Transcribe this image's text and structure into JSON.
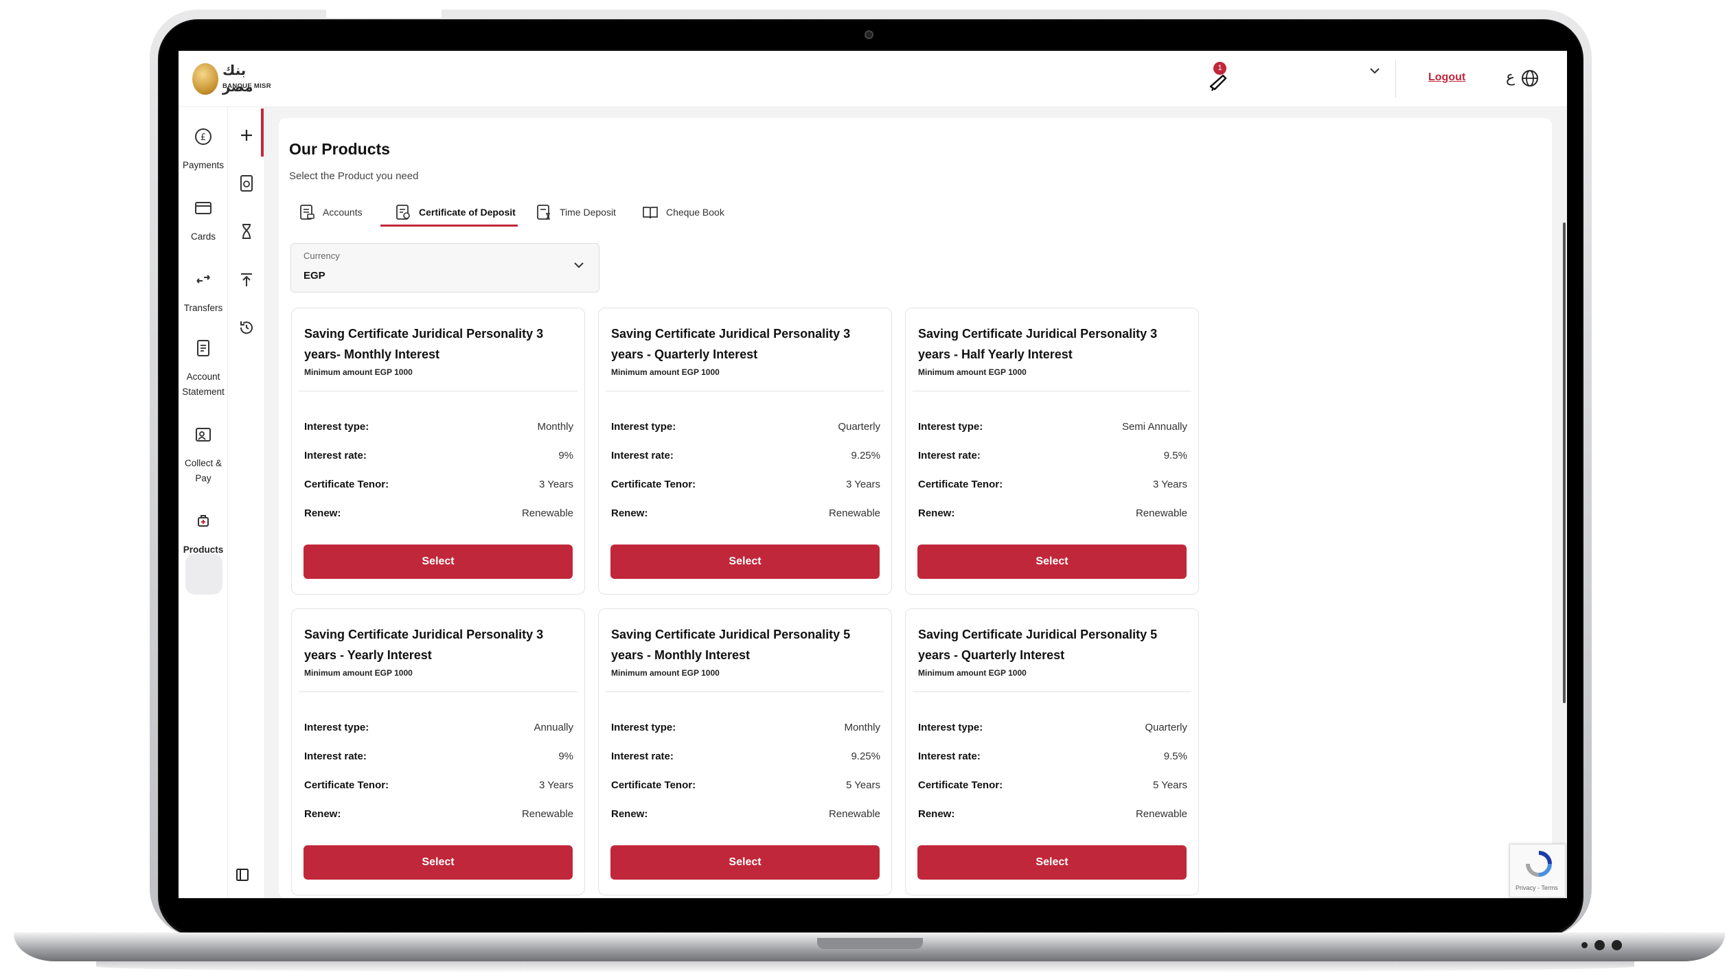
{
  "brand": {
    "arabic_name": "بنك مصر",
    "name": "BANQUE MISR"
  },
  "header": {
    "notification_count": "1",
    "logout_label": "Logout",
    "language_label": "ع"
  },
  "sidebar": {
    "items": [
      {
        "label": "Payments",
        "icon": "pound-coin-icon"
      },
      {
        "label": "Cards",
        "icon": "card-icon"
      },
      {
        "label": "Transfers",
        "icon": "transfer-arrows-icon"
      },
      {
        "label": "Account Statement",
        "icon": "statement-icon"
      },
      {
        "label": "Collect & Pay",
        "icon": "collect-pay-icon"
      },
      {
        "label": "Products",
        "icon": "products-icon",
        "active": true
      }
    ]
  },
  "quick_bar": {
    "icons": [
      "plus-icon",
      "document-money-icon",
      "hourglass-icon",
      "upload-icon",
      "history-icon",
      "collapse-panel-icon"
    ]
  },
  "main": {
    "title": "Our Products",
    "subtitle": "Select the Product you need",
    "tabs": [
      {
        "label": "Accounts",
        "active": false
      },
      {
        "label": "Certificate of Deposit",
        "active": true
      },
      {
        "label": "Time Deposit",
        "active": false
      },
      {
        "label": "Cheque Book",
        "active": false
      }
    ],
    "currency": {
      "label": "Currency",
      "value": "EGP"
    },
    "labels": {
      "interest_type": "Interest type:",
      "interest_rate": "Interest rate:",
      "tenor": "Certificate Tenor:",
      "renew": "Renew:",
      "select": "Select"
    },
    "cards": [
      {
        "title": "Saving Certificate Juridical Personality 3 years- Monthly Interest",
        "min": "Minimum amount EGP 1000",
        "interest_type": "Monthly",
        "interest_rate": "9%",
        "tenor": "3 Years",
        "renew": "Renewable"
      },
      {
        "title": "Saving Certificate Juridical Personality 3 years - Quarterly Interest",
        "min": "Minimum amount EGP 1000",
        "interest_type": "Quarterly",
        "interest_rate": "9.25%",
        "tenor": "3 Years",
        "renew": "Renewable"
      },
      {
        "title": "Saving Certificate Juridical Personality 3 years - Half Yearly Interest",
        "min": "Minimum amount EGP 1000",
        "interest_type": "Semi Annually",
        "interest_rate": "9.5%",
        "tenor": "3 Years",
        "renew": "Renewable"
      },
      {
        "title": "Saving Certificate Juridical Personality 3 years - Yearly Interest",
        "min": "Minimum amount EGP 1000",
        "interest_type": "Annually",
        "interest_rate": "9%",
        "tenor": "3 Years",
        "renew": "Renewable"
      },
      {
        "title": "Saving Certificate Juridical Personality 5 years - Monthly Interest",
        "min": "Minimum amount EGP 1000",
        "interest_type": "Monthly",
        "interest_rate": "9.25%",
        "tenor": "5 Years",
        "renew": "Renewable"
      },
      {
        "title": "Saving Certificate Juridical Personality 5 years - Quarterly Interest",
        "min": "Minimum amount EGP 1000",
        "interest_type": "Quarterly",
        "interest_rate": "9.5%",
        "tenor": "5 Years",
        "renew": "Renewable"
      }
    ]
  },
  "recaptcha": {
    "text": "Privacy - Terms"
  },
  "colors": {
    "accent": "#c1273a",
    "background": "#f3f3f4"
  }
}
